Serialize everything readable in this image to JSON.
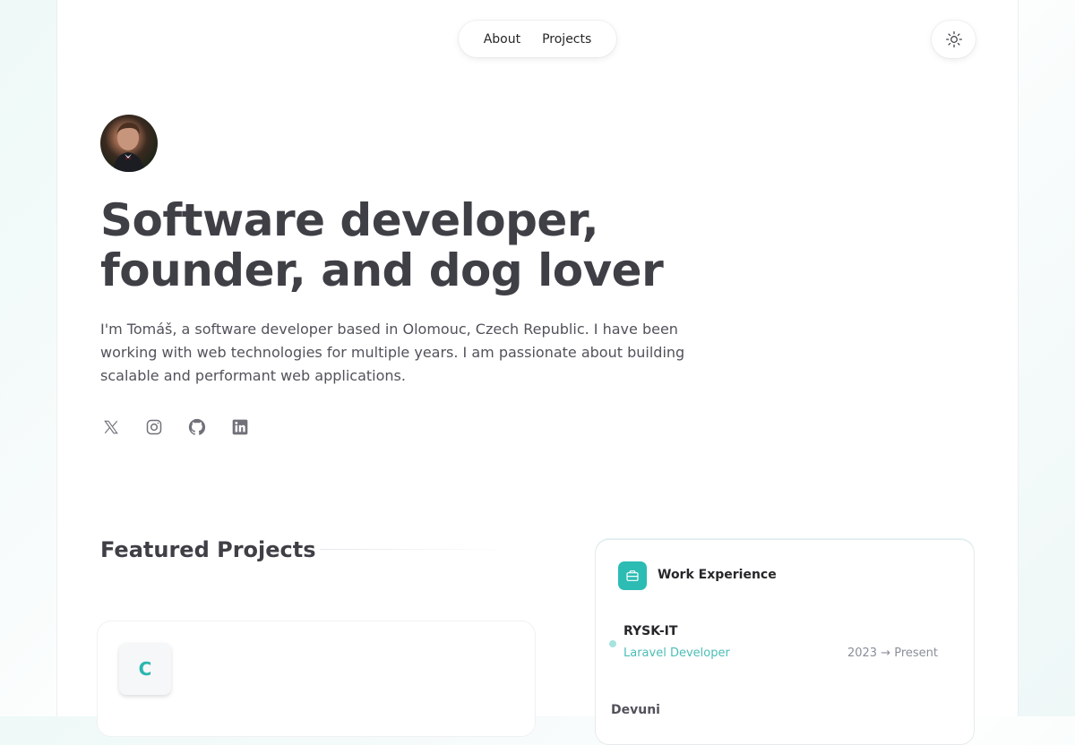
{
  "nav": {
    "items": [
      {
        "label": "About"
      },
      {
        "label": "Projects"
      }
    ]
  },
  "theme_toggle": {
    "icon": "sun-icon"
  },
  "hero": {
    "avatar": "profile-photo",
    "headline_line1": "Software developer,",
    "headline_line2": "founder, and dog lover",
    "intro": "I'm Tomáš, a software developer based in Olomouc, Czech Republic. I have been working with web technologies for multiple years. I am passionate about building scalable and performant web applications.",
    "socials": [
      "x-icon",
      "instagram-icon",
      "github-icon",
      "linkedin-icon"
    ]
  },
  "featured": {
    "title": "Featured Projects",
    "projects": [
      {
        "logo_letter": "C"
      }
    ]
  },
  "work": {
    "title": "Work Experience",
    "icon": "briefcase-icon",
    "jobs": [
      {
        "company": "RYSK-IT",
        "role": "Laravel Developer",
        "dates": "2023 → Present"
      },
      {
        "company": "Devuni"
      }
    ]
  },
  "colors": {
    "accent": "#2cbcb3",
    "text": "#3f3f46",
    "muted": "#52525b"
  }
}
